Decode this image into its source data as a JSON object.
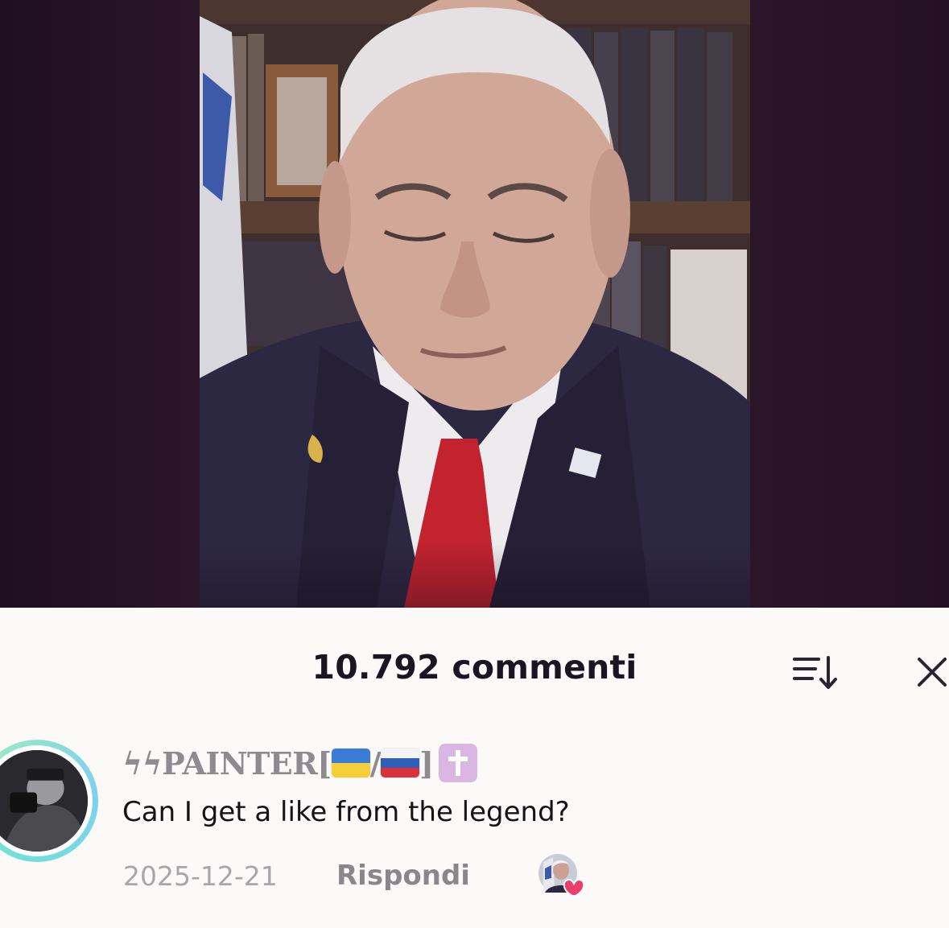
{
  "video": {
    "description_icon": "video-frame"
  },
  "comments": {
    "count_label": "10.792 commenti",
    "sort_icon": "sort-icon",
    "close_icon": "close-icon"
  },
  "comment": {
    "username_prefix": "ϟϟPAINTER[",
    "username_sep": "/",
    "username_suffix": "]",
    "text": "Can I get a like from the legend?",
    "date": "2025-12-21",
    "reply_label": "Rispondi",
    "liked_by_creator_icon": "creator-heart-icon"
  },
  "colors": {
    "title": "#1a1520",
    "username": "#8e8a90",
    "meta": "#a9a6ab",
    "heart": "#e8406a",
    "ring": "#6fe0d8"
  }
}
